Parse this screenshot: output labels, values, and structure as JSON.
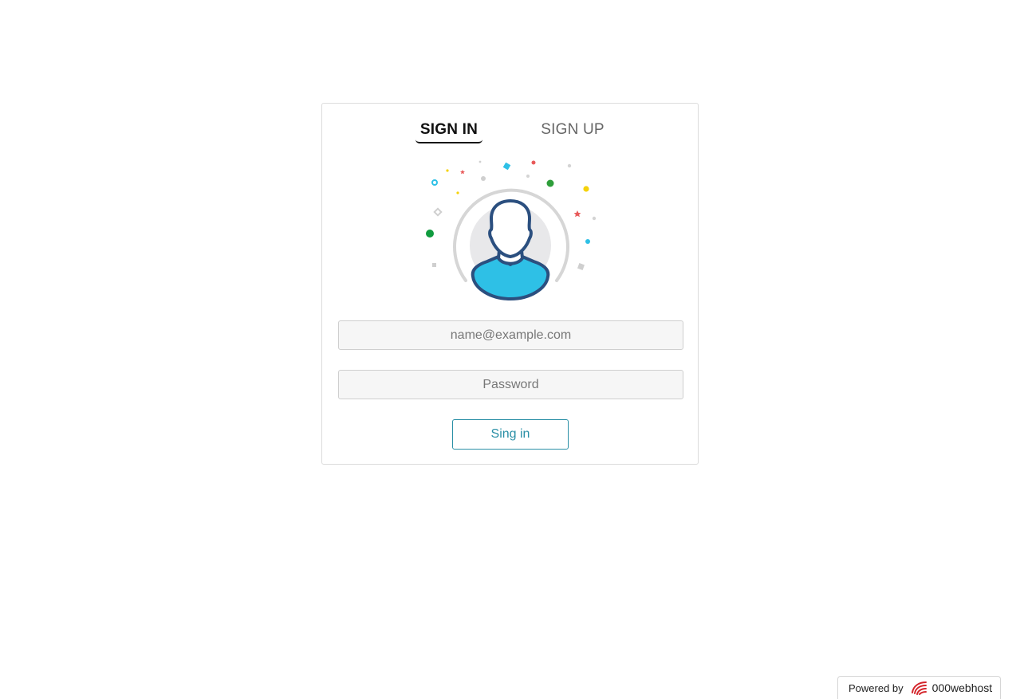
{
  "tabs": {
    "sign_in": "SIGN IN",
    "sign_up": "SIGN UP",
    "active": "sign_in"
  },
  "form": {
    "email_placeholder": "name@example.com",
    "email_value": "",
    "password_placeholder": "Password",
    "password_value": "",
    "submit_label": "Sing in"
  },
  "footer": {
    "powered_by": "Powered by",
    "brand": "000webhost"
  },
  "colors": {
    "accent": "#2a8fa6",
    "avatar_body": "#2ec0e6",
    "avatar_outline": "#2b4f7f",
    "brand_red": "#d4262c"
  },
  "icons": {
    "avatar": "user-avatar-icon",
    "brand_logo": "000webhost-logo-icon"
  }
}
